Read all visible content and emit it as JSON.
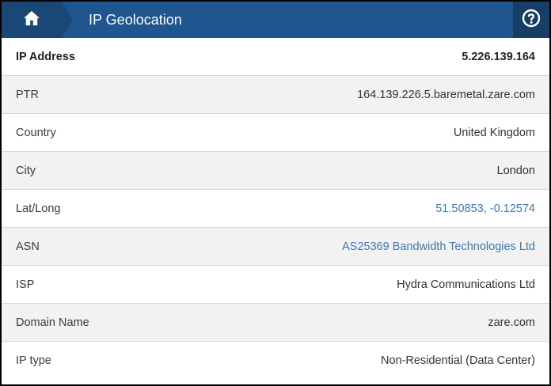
{
  "header": {
    "home_icon": "home-icon",
    "title": "IP Geolocation",
    "help_icon": "question-circle-icon"
  },
  "rows": [
    {
      "label": "IP Address",
      "value": "5.226.139.164"
    },
    {
      "label": "PTR",
      "value": "164.139.226.5.baremetal.zare.com"
    },
    {
      "label": "Country",
      "value": "United Kingdom"
    },
    {
      "label": "City",
      "value": "London"
    },
    {
      "label": "Lat/Long",
      "value": "51.50853, -0.12574"
    },
    {
      "label": "ASN",
      "value": "AS25369 Bandwidth Technologies Ltd"
    },
    {
      "label": "ISP",
      "value": "Hydra Communications Ltd"
    },
    {
      "label": "Domain Name",
      "value": "zare.com"
    },
    {
      "label": "IP type",
      "value": "Non-Residential (Data Center)"
    }
  ],
  "colors": {
    "header_bg": "#20568f",
    "home_bg": "#1a4876",
    "help_bg": "#163e66",
    "link": "#3b7ab8"
  }
}
